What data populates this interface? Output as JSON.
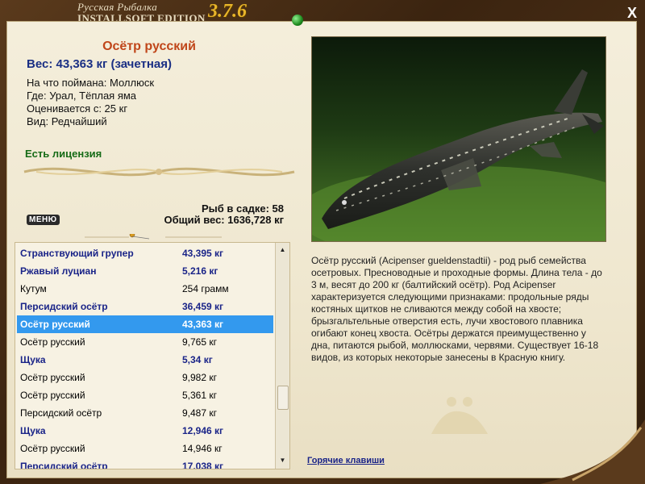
{
  "app": {
    "title_line1": "Русская Рыбалка",
    "title_line2": "INSTALLSOFT EDITION",
    "version": "3.7.6",
    "close_label": "X"
  },
  "fish": {
    "name": "Осётр русский",
    "weight_line": "Вес: 43,363 кг (зачетная)",
    "caught_on": "На что поймана: Моллюск",
    "location": "Где: Урал, Тёплая яма",
    "rated_from": "Оценивается с: 25 кг",
    "kind": "Вид: Редчайший",
    "license": "Есть лицензия"
  },
  "stats": {
    "fish_in_keepnet": "Рыб в садке: 58",
    "total_weight": "Общий вес: 1636,728 кг"
  },
  "menu_label": "МЕНЮ",
  "list": {
    "rows": [
      {
        "name": "Странствующий групер",
        "weight": "43,395 кг",
        "style": "bold"
      },
      {
        "name": "Ржавый луциан",
        "weight": "5,216 кг",
        "style": "bold"
      },
      {
        "name": "Кутум",
        "weight": "254 грамм",
        "style": "normal"
      },
      {
        "name": "Персидский осётр",
        "weight": "36,459 кг",
        "style": "bold"
      },
      {
        "name": "Осётр русский",
        "weight": "43,363 кг",
        "style": "selected"
      },
      {
        "name": "Осётр русский",
        "weight": "9,765 кг",
        "style": "normal"
      },
      {
        "name": "Щука",
        "weight": "5,34 кг",
        "style": "bold"
      },
      {
        "name": "Осётр русский",
        "weight": "9,982 кг",
        "style": "normal"
      },
      {
        "name": "Осётр русский",
        "weight": "5,361 кг",
        "style": "normal"
      },
      {
        "name": "Персидский осётр",
        "weight": "9,487 кг",
        "style": "normal"
      },
      {
        "name": "Щука",
        "weight": "12,946 кг",
        "style": "bold"
      },
      {
        "name": "Осётр русский",
        "weight": "14,946 кг",
        "style": "normal"
      },
      {
        "name": "Персидский осётр",
        "weight": "17,038 кг",
        "style": "bold"
      }
    ]
  },
  "description": "Осётр русский (Acipenser gueldenstadtii) - род рыб семейства осетровых. Пресноводные и проходные формы. Длина тела - до 3 м, весят до 200 кг (балтийский осётр). Род Acipenser характеризуется следующими признаками: продольные ряды костяных щитков не сливаются между собой на хвосте; брызгальтельные отверстия есть, лучи хвостового плавника огибают конец хвоста. Осётры держатся преимущественно у дна, питаются рыбой, моллюсками, червями. Существует 16-18 видов, из которых некоторые занесены в Красную книгу.",
  "hotkeys_label": "Горячие клавиши",
  "colors": {
    "accent_title": "#c0461a",
    "weight_blue": "#1a2f84",
    "license_green": "#166b16",
    "selection": "#3399ee",
    "version_gold": "#e8b52a"
  }
}
